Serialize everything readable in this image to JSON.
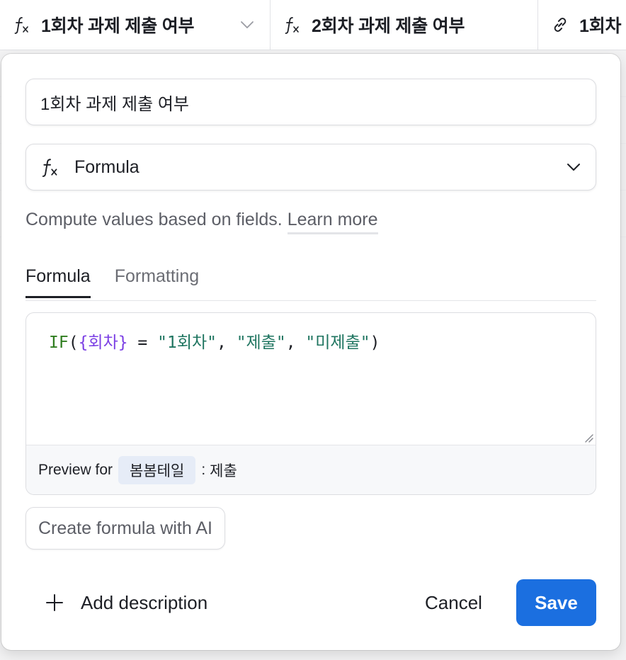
{
  "table": {
    "columns": [
      {
        "title": "1회차 과제 제출 여부",
        "icon": "formula-icon"
      },
      {
        "title": "2회차 과제 제출 여부",
        "icon": "formula-icon"
      },
      {
        "title": "1회차 과",
        "icon": "link-icon"
      }
    ]
  },
  "dialog": {
    "field_name": "1회차 과제 제출 여부",
    "field_type": {
      "label": "Formula",
      "icon": "formula-icon"
    },
    "helper_text": "Compute values based on fields.",
    "learn_more": "Learn more",
    "tabs": [
      {
        "label": "Formula",
        "active": true
      },
      {
        "label": "Formatting",
        "active": false
      }
    ],
    "formula": {
      "function": "IF",
      "open_paren": "(",
      "field": "{회차}",
      "operator": " = ",
      "str1": "\"1회차\"",
      "comma1": ", ",
      "str2": "\"제출\"",
      "comma2": ", ",
      "str3": "\"미제출\"",
      "close_paren": ")"
    },
    "preview": {
      "label": "Preview for",
      "record": "봄봄테일",
      "separator": ":",
      "value": "제출"
    },
    "ai_button": "Create formula with AI",
    "add_description": "Add description",
    "cancel": "Cancel",
    "save": "Save"
  },
  "colors": {
    "primary": "#1b6fe0",
    "formula_function": "#2f7d1f",
    "formula_field": "#7b3fe4",
    "formula_string": "#1f7560"
  }
}
